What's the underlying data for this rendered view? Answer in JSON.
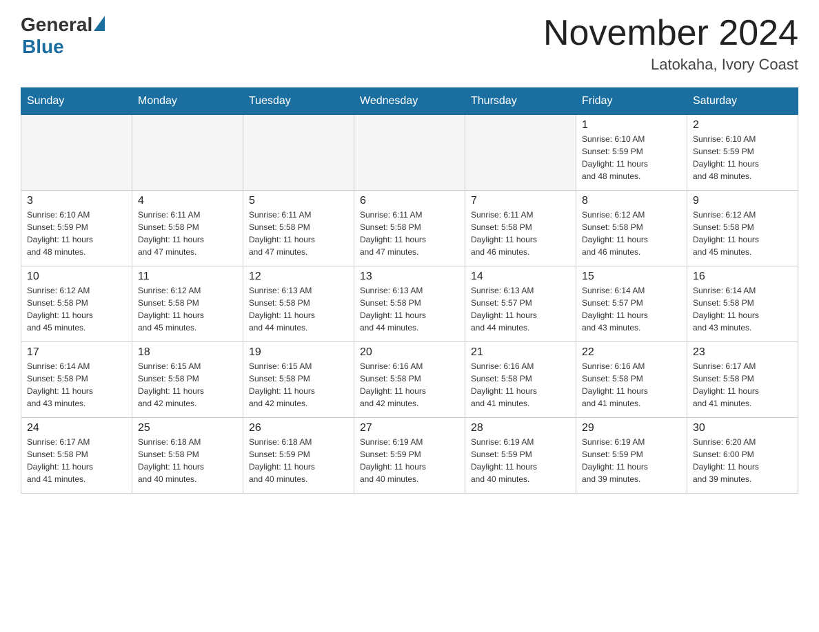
{
  "logo": {
    "general": "General",
    "blue": "Blue"
  },
  "title": "November 2024",
  "location": "Latokaha, Ivory Coast",
  "weekdays": [
    "Sunday",
    "Monday",
    "Tuesday",
    "Wednesday",
    "Thursday",
    "Friday",
    "Saturday"
  ],
  "weeks": [
    [
      {
        "day": "",
        "info": ""
      },
      {
        "day": "",
        "info": ""
      },
      {
        "day": "",
        "info": ""
      },
      {
        "day": "",
        "info": ""
      },
      {
        "day": "",
        "info": ""
      },
      {
        "day": "1",
        "info": "Sunrise: 6:10 AM\nSunset: 5:59 PM\nDaylight: 11 hours\nand 48 minutes."
      },
      {
        "day": "2",
        "info": "Sunrise: 6:10 AM\nSunset: 5:59 PM\nDaylight: 11 hours\nand 48 minutes."
      }
    ],
    [
      {
        "day": "3",
        "info": "Sunrise: 6:10 AM\nSunset: 5:59 PM\nDaylight: 11 hours\nand 48 minutes."
      },
      {
        "day": "4",
        "info": "Sunrise: 6:11 AM\nSunset: 5:58 PM\nDaylight: 11 hours\nand 47 minutes."
      },
      {
        "day": "5",
        "info": "Sunrise: 6:11 AM\nSunset: 5:58 PM\nDaylight: 11 hours\nand 47 minutes."
      },
      {
        "day": "6",
        "info": "Sunrise: 6:11 AM\nSunset: 5:58 PM\nDaylight: 11 hours\nand 47 minutes."
      },
      {
        "day": "7",
        "info": "Sunrise: 6:11 AM\nSunset: 5:58 PM\nDaylight: 11 hours\nand 46 minutes."
      },
      {
        "day": "8",
        "info": "Sunrise: 6:12 AM\nSunset: 5:58 PM\nDaylight: 11 hours\nand 46 minutes."
      },
      {
        "day": "9",
        "info": "Sunrise: 6:12 AM\nSunset: 5:58 PM\nDaylight: 11 hours\nand 45 minutes."
      }
    ],
    [
      {
        "day": "10",
        "info": "Sunrise: 6:12 AM\nSunset: 5:58 PM\nDaylight: 11 hours\nand 45 minutes."
      },
      {
        "day": "11",
        "info": "Sunrise: 6:12 AM\nSunset: 5:58 PM\nDaylight: 11 hours\nand 45 minutes."
      },
      {
        "day": "12",
        "info": "Sunrise: 6:13 AM\nSunset: 5:58 PM\nDaylight: 11 hours\nand 44 minutes."
      },
      {
        "day": "13",
        "info": "Sunrise: 6:13 AM\nSunset: 5:58 PM\nDaylight: 11 hours\nand 44 minutes."
      },
      {
        "day": "14",
        "info": "Sunrise: 6:13 AM\nSunset: 5:57 PM\nDaylight: 11 hours\nand 44 minutes."
      },
      {
        "day": "15",
        "info": "Sunrise: 6:14 AM\nSunset: 5:57 PM\nDaylight: 11 hours\nand 43 minutes."
      },
      {
        "day": "16",
        "info": "Sunrise: 6:14 AM\nSunset: 5:58 PM\nDaylight: 11 hours\nand 43 minutes."
      }
    ],
    [
      {
        "day": "17",
        "info": "Sunrise: 6:14 AM\nSunset: 5:58 PM\nDaylight: 11 hours\nand 43 minutes."
      },
      {
        "day": "18",
        "info": "Sunrise: 6:15 AM\nSunset: 5:58 PM\nDaylight: 11 hours\nand 42 minutes."
      },
      {
        "day": "19",
        "info": "Sunrise: 6:15 AM\nSunset: 5:58 PM\nDaylight: 11 hours\nand 42 minutes."
      },
      {
        "day": "20",
        "info": "Sunrise: 6:16 AM\nSunset: 5:58 PM\nDaylight: 11 hours\nand 42 minutes."
      },
      {
        "day": "21",
        "info": "Sunrise: 6:16 AM\nSunset: 5:58 PM\nDaylight: 11 hours\nand 41 minutes."
      },
      {
        "day": "22",
        "info": "Sunrise: 6:16 AM\nSunset: 5:58 PM\nDaylight: 11 hours\nand 41 minutes."
      },
      {
        "day": "23",
        "info": "Sunrise: 6:17 AM\nSunset: 5:58 PM\nDaylight: 11 hours\nand 41 minutes."
      }
    ],
    [
      {
        "day": "24",
        "info": "Sunrise: 6:17 AM\nSunset: 5:58 PM\nDaylight: 11 hours\nand 41 minutes."
      },
      {
        "day": "25",
        "info": "Sunrise: 6:18 AM\nSunset: 5:58 PM\nDaylight: 11 hours\nand 40 minutes."
      },
      {
        "day": "26",
        "info": "Sunrise: 6:18 AM\nSunset: 5:59 PM\nDaylight: 11 hours\nand 40 minutes."
      },
      {
        "day": "27",
        "info": "Sunrise: 6:19 AM\nSunset: 5:59 PM\nDaylight: 11 hours\nand 40 minutes."
      },
      {
        "day": "28",
        "info": "Sunrise: 6:19 AM\nSunset: 5:59 PM\nDaylight: 11 hours\nand 40 minutes."
      },
      {
        "day": "29",
        "info": "Sunrise: 6:19 AM\nSunset: 5:59 PM\nDaylight: 11 hours\nand 39 minutes."
      },
      {
        "day": "30",
        "info": "Sunrise: 6:20 AM\nSunset: 6:00 PM\nDaylight: 11 hours\nand 39 minutes."
      }
    ]
  ]
}
